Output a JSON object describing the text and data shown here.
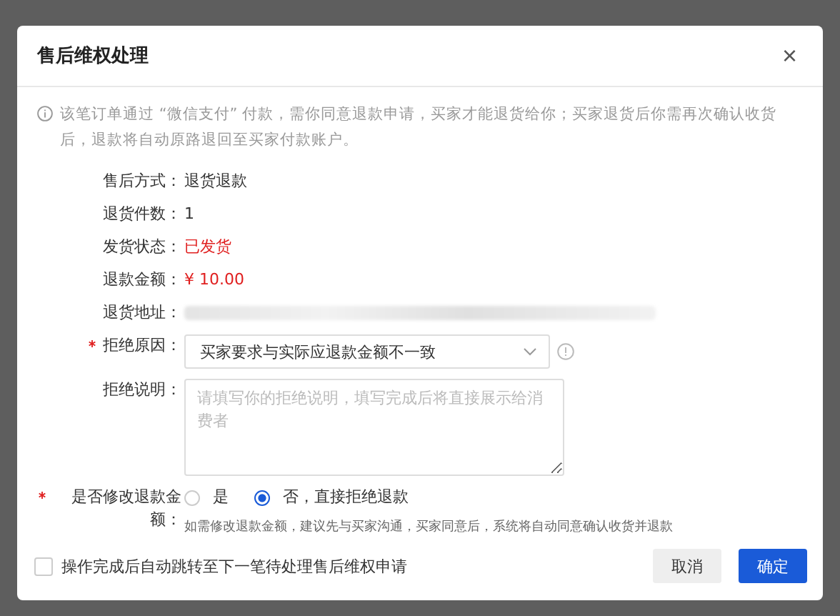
{
  "dialog": {
    "title": "售后维权处理",
    "close": "×"
  },
  "notice": "该笔订单通过 “微信支付” 付款，需你同意退款申请，买家才能退货给你；买家退货后你需再次确认收货后，退款将自动原路退回至买家付款账户。",
  "details": [
    {
      "label": "售后方式：",
      "value": "退货退款",
      "kind": "plain"
    },
    {
      "label": "退货件数：",
      "value": "1",
      "kind": "plain"
    },
    {
      "label": "发货状态：",
      "value": "已发货",
      "kind": "alert"
    },
    {
      "label": "退款金额：",
      "value": "¥ 10.00",
      "kind": "alert"
    },
    {
      "label": "退货地址：",
      "kind": "redacted"
    }
  ],
  "form": {
    "reason": {
      "required": true,
      "label": "拒绝原因：",
      "value": "买家要求与实际应退款金额不一致"
    },
    "explanation": {
      "required": false,
      "label": "拒绝说明：",
      "placeholder": "请填写你的拒绝说明，填写完成后将直接展示给消费者"
    },
    "modify_amount": {
      "required": true,
      "label": "是否修改退款金额：",
      "options": [
        {
          "label": "是",
          "selected": false
        },
        {
          "label": "否，直接拒绝退款",
          "selected": true
        }
      ],
      "hint": "如需修改退款金额，建议先与买家沟通，买家同意后，系统将自动同意确认收货并退款"
    }
  },
  "footer": {
    "auto_next": {
      "label": "操作完成后自动跳转至下一笔待处理售后维权申请",
      "checked": false
    },
    "buttons": [
      {
        "label": "取消",
        "kind": "secondary"
      },
      {
        "label": "确定",
        "kind": "primary"
      }
    ]
  }
}
